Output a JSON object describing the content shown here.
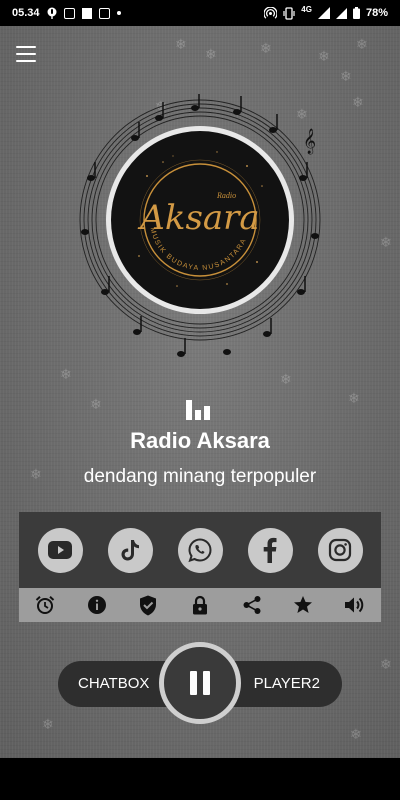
{
  "status_bar": {
    "time": "05.34",
    "battery": "78%",
    "network": "4G"
  },
  "station": {
    "logo_small_text": "Radio",
    "logo_brand_text": "Aksara",
    "logo_ring_text": "MUSIK BUDAYA NUSANTARA",
    "name": "Radio Aksara",
    "tagline": "dendang minang terpopuler"
  },
  "social": [
    {
      "name": "youtube-icon"
    },
    {
      "name": "tiktok-icon"
    },
    {
      "name": "whatsapp-icon"
    },
    {
      "name": "facebook-icon"
    },
    {
      "name": "instagram-icon"
    }
  ],
  "toolbar": [
    {
      "name": "alarm-icon"
    },
    {
      "name": "info-icon"
    },
    {
      "name": "shield-check-icon"
    },
    {
      "name": "lock-icon"
    },
    {
      "name": "share-icon"
    },
    {
      "name": "star-icon"
    },
    {
      "name": "volume-icon"
    }
  ],
  "player": {
    "left_label": "CHATBOX",
    "right_label": "PLAYER2",
    "state": "playing"
  },
  "colors": {
    "background": "#6d6d6d",
    "social_bar": "#3b3b3b",
    "tool_bar": "#9d9d9d",
    "pill": "#2e2e2e",
    "logo_gold": "#c8903a"
  }
}
